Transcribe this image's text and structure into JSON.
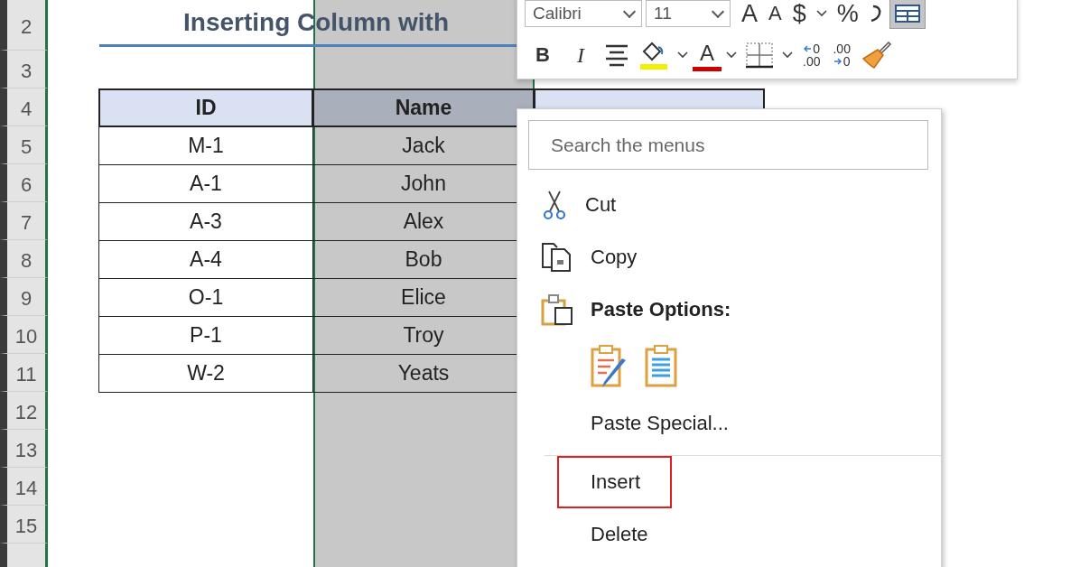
{
  "sheet": {
    "row_headers": [
      "2",
      "3",
      "4",
      "5",
      "6",
      "7",
      "8",
      "9",
      "10",
      "11",
      "12",
      "13",
      "14",
      "15"
    ],
    "title": "Inserting Column with",
    "columns": [
      {
        "header": "ID",
        "selected": false
      },
      {
        "header": "Name",
        "selected": true
      },
      {
        "selected": false
      }
    ],
    "rows": [
      [
        "M-1",
        "Jack"
      ],
      [
        "A-1",
        "John"
      ],
      [
        "A-3",
        "Alex"
      ],
      [
        "A-4",
        "Bob"
      ],
      [
        "O-1",
        "Elice"
      ],
      [
        "P-1",
        "Troy"
      ],
      [
        "W-2",
        "Yeats"
      ]
    ]
  },
  "mini_toolbar": {
    "font": "Calibri",
    "size": "11",
    "row_1": [
      {
        "kind": "grow-font",
        "text": "A",
        "pressed": false
      },
      {
        "kind": "shrink-font",
        "text": "A",
        "pressed": false
      },
      {
        "kind": "glyph",
        "text": "$",
        "pressed": false
      },
      {
        "kind": "caret",
        "pressed": false
      },
      {
        "kind": "glyph",
        "text": "%",
        "pressed": false
      },
      {
        "kind": "comma",
        "pressed": false
      },
      {
        "kind": "table-format",
        "pressed": true
      }
    ],
    "row_2": [
      {
        "kind": "bold",
        "text": "B",
        "pressed": false
      },
      {
        "kind": "italic",
        "text": "I",
        "pressed": false
      },
      {
        "kind": "align",
        "pressed": false
      },
      {
        "kind": "fill",
        "pressed": false
      },
      {
        "kind": "caret",
        "pressed": false
      },
      {
        "kind": "font-color",
        "text": "A",
        "pressed": false
      },
      {
        "kind": "caret",
        "pressed": false
      },
      {
        "kind": "borders",
        "pressed": false
      },
      {
        "kind": "caret",
        "pressed": false
      },
      {
        "kind": "decimal-increase",
        "texts": [
          "0",
          ".00"
        ],
        "pressed": false
      },
      {
        "kind": "decimal-decrease",
        "texts": [
          ".00",
          "0"
        ],
        "pressed": false
      },
      {
        "kind": "painter",
        "pressed": false
      }
    ]
  },
  "context_menu": {
    "search_placeholder": "Search the menus",
    "items": [
      {
        "kind": "cut",
        "label": "Cut",
        "highlighted": false
      },
      {
        "kind": "copy",
        "label": "Copy",
        "highlighted": false
      },
      {
        "kind": "heading",
        "label": "Paste Options:",
        "highlighted": false
      },
      {
        "kind": "paste-options",
        "highlighted": false
      },
      {
        "kind": "plain",
        "label": "Paste Special...",
        "highlighted": false
      },
      {
        "kind": "separator",
        "highlighted": false
      },
      {
        "kind": "plain",
        "label": "Insert",
        "highlighted": true
      },
      {
        "kind": "plain",
        "label": "Delete",
        "highlighted": false
      }
    ]
  }
}
